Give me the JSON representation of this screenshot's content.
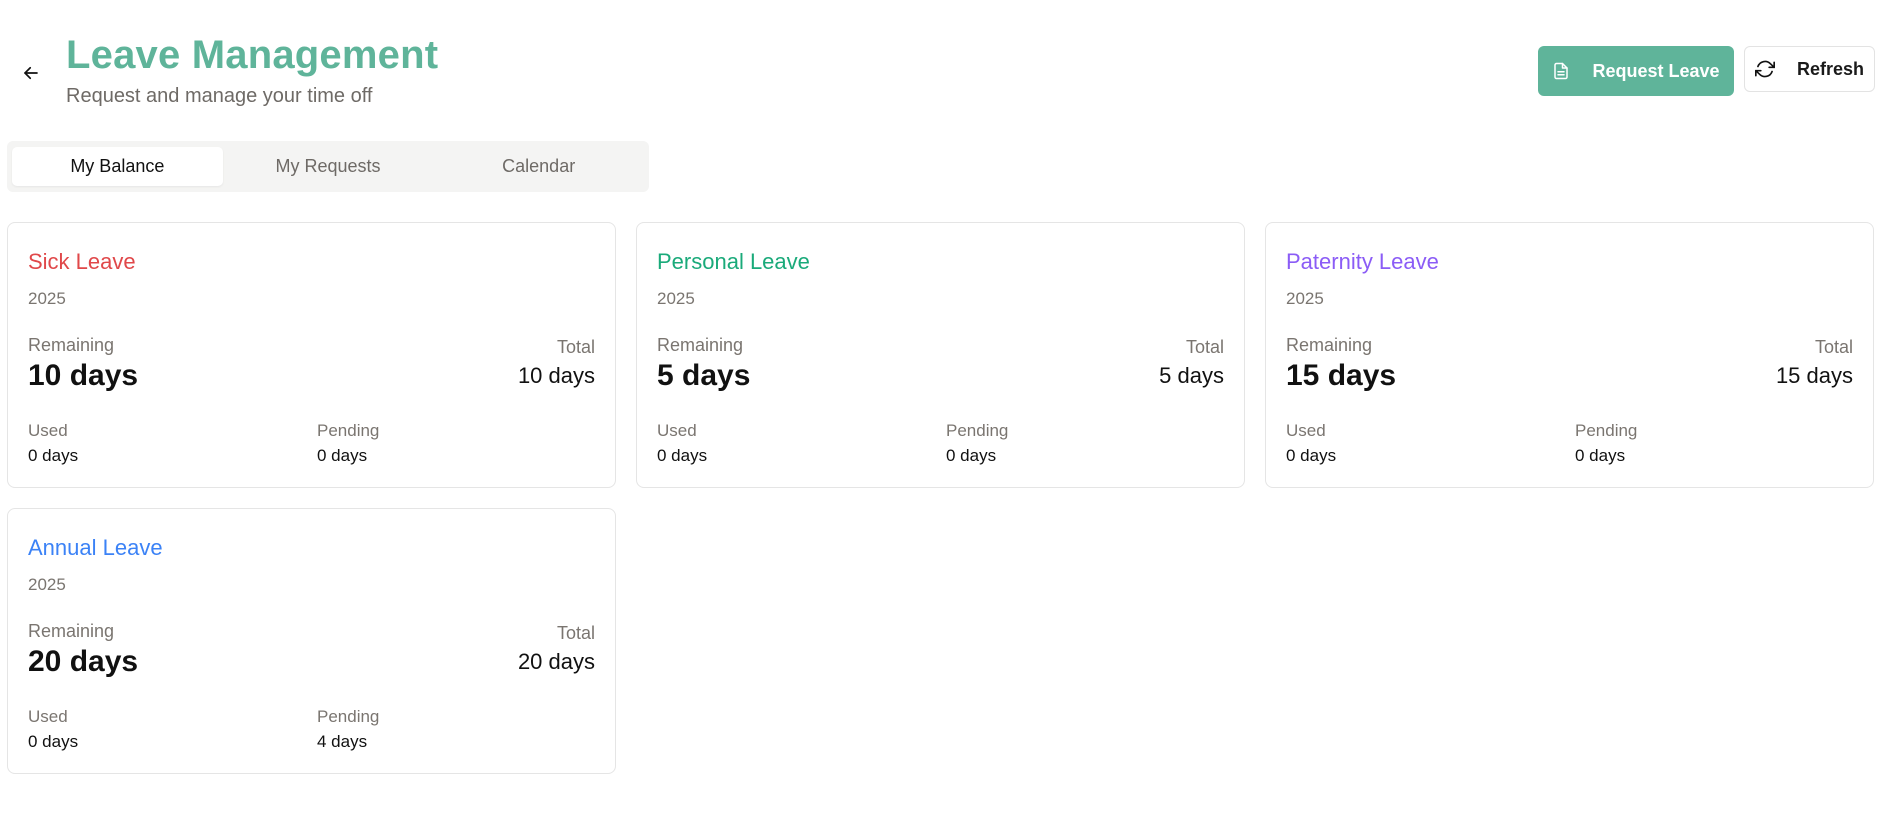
{
  "header": {
    "back_icon": "arrow-left-icon",
    "title": "Leave Management",
    "subtitle": "Request and manage your time off",
    "request_button": {
      "label": "Request Leave",
      "icon": "document-icon"
    },
    "refresh_button": {
      "label": "Refresh",
      "icon": "refresh-icon"
    }
  },
  "tabs": [
    {
      "label": "My Balance",
      "active": true
    },
    {
      "label": "My Requests",
      "active": false
    },
    {
      "label": "Calendar",
      "active": false
    }
  ],
  "labels": {
    "remaining": "Remaining",
    "total": "Total",
    "used": "Used",
    "pending": "Pending"
  },
  "cards": [
    {
      "title": "Sick Leave",
      "color": "#e0484a",
      "year": "2025",
      "remaining": "10 days",
      "total": "10 days",
      "used": "0 days",
      "pending": "0 days"
    },
    {
      "title": "Personal Leave",
      "color": "#1aaa7a",
      "year": "2025",
      "remaining": "5 days",
      "total": "5 days",
      "used": "0 days",
      "pending": "0 days"
    },
    {
      "title": "Paternity Leave",
      "color": "#8b5cf6",
      "year": "2025",
      "remaining": "15 days",
      "total": "15 days",
      "used": "0 days",
      "pending": "0 days"
    },
    {
      "title": "Annual Leave",
      "color": "#3b82f6",
      "year": "2025",
      "remaining": "20 days",
      "total": "20 days",
      "used": "0 days",
      "pending": "4 days"
    }
  ],
  "colors": {
    "accent": "#5fb49a",
    "muted_text": "#7a7570"
  }
}
